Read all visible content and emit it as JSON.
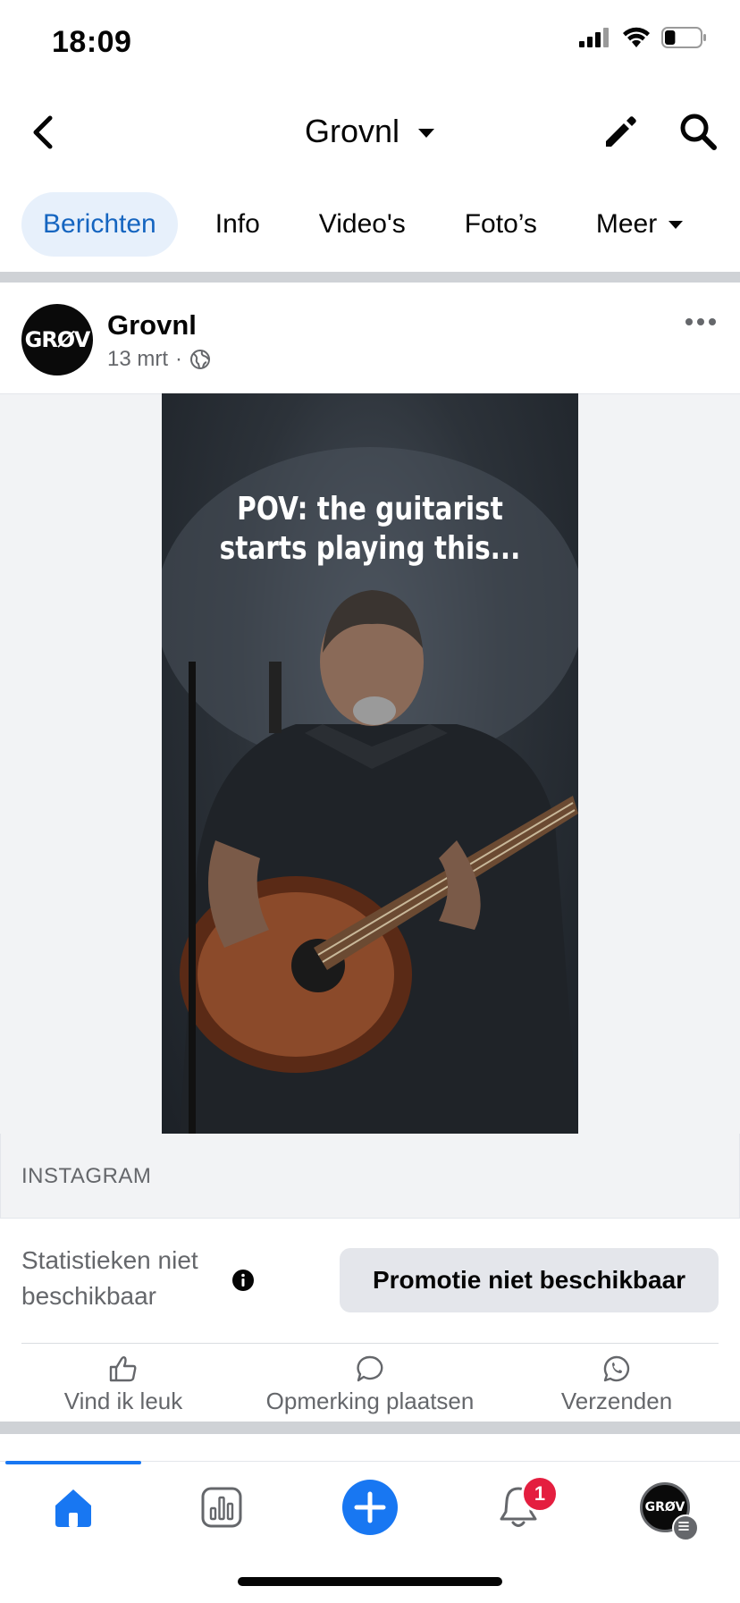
{
  "status_bar": {
    "time": "18:09",
    "battery_percent": 30
  },
  "header": {
    "title": "Grovnl"
  },
  "tabs": [
    {
      "label": "Berichten",
      "active": true
    },
    {
      "label": "Info",
      "active": false
    },
    {
      "label": "Video's",
      "active": false
    },
    {
      "label": "Foto’s",
      "active": false
    },
    {
      "label": "Meer",
      "active": false
    }
  ],
  "post": {
    "author": "Grovnl",
    "avatar_text": "GRØV",
    "date": "13 mrt",
    "separator": "·",
    "video_caption": "POV: the guitarist starts playing this...",
    "link_source": "INSTAGRAM",
    "stats_text": "Statistieken niet beschikbaar",
    "promo_label": "Promotie niet beschikbaar"
  },
  "actions": {
    "like": "Vind ik leuk",
    "comment": "Opmerking plaatsen",
    "share": "Verzenden"
  },
  "bottom_nav": {
    "notification_count": "1",
    "avatar_text": "GRØV"
  },
  "colors": {
    "accent": "#1877f2",
    "active_tab_bg": "#e7f0fb",
    "active_tab_text": "#1565c0",
    "badge": "#e41e3f",
    "secondary_text": "#65676b"
  }
}
